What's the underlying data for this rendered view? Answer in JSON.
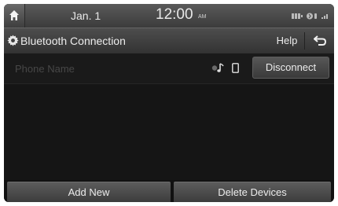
{
  "status_bar": {
    "date": "Jan.  1",
    "time": "12:00",
    "ampm": "AM",
    "icons": [
      "battery-icon",
      "bluetooth-phone-icon",
      "signal-icon"
    ]
  },
  "header": {
    "title": "Bluetooth Connection",
    "help_label": "Help",
    "icons": [
      "gear-icon",
      "back-arrow-icon"
    ]
  },
  "device": {
    "name": "Phone Name",
    "disconnect_label": "Disconnect",
    "icons": [
      "audio-streaming-icon",
      "phone-icon"
    ]
  },
  "footer": {
    "add_new_label": "Add New",
    "delete_devices_label": "Delete Devices"
  },
  "colors": {
    "screen_bg": "#151515",
    "text": "#ececec",
    "placeholder_text": "#474747"
  }
}
